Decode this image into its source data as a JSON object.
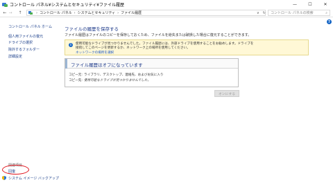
{
  "window": {
    "title": "コントロール パネル¥システムとセキュリティ¥ファイル履歴",
    "minimize": "—",
    "maximize": "☐",
    "close": "✕"
  },
  "address": {
    "back": "←",
    "forward": "→",
    "up": "↑",
    "crumbs": [
      "コントロール パネル",
      "システムとセキュリティ",
      "ファイル履歴"
    ],
    "dropdown": "∨",
    "refresh": "↻",
    "search_placeholder": "コントロール パネルの検索",
    "search_icon": "⌕"
  },
  "help": "?",
  "sidebar": {
    "home": "コントロール パネル ホーム",
    "links": [
      "個人用ファイルの復元",
      "ドライブの選択",
      "除外するフォルダー",
      "詳細設定"
    ],
    "related_heading": "関連項目",
    "related_links": [
      "回復",
      "システム イメージ バックアップ"
    ]
  },
  "main": {
    "title": "ファイルの履歴を保存する",
    "description": "ファイル履歴はファイルのコピーを保存しておくため、ファイルを紛失または破損した場合に復元することができます。",
    "info": {
      "icon": "i",
      "line1": "使用可能なドライブが見つかりませんでした。ファイル履歴には、外部ドライブを使用することをお勧めします。ドライブを",
      "line2": "接続してこのページを更新するか、ネットワーク上の場所を使用してください。",
      "link": "ネットワークの場所を選択"
    },
    "status": {
      "title": "ファイル履歴はオフになっています",
      "copy_from_label": "コピー元:",
      "copy_from_value": "ライブラリ、デスクトップ、連絡先、およびお気に入り",
      "copy_to_label": "コピー先:",
      "copy_to_value": "使用可能なドライブが見つかりませんでした。"
    },
    "on_button": "オンにする"
  }
}
